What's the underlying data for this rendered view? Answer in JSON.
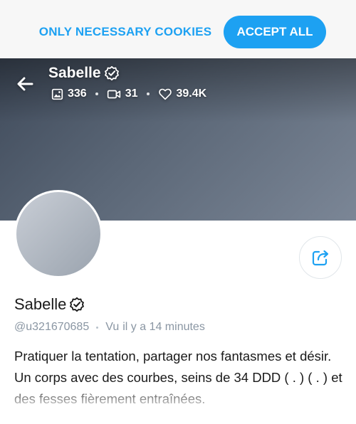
{
  "cookie_banner": {
    "necessary_label": "ONLY NECESSARY COOKIES",
    "accept_label": "ACCEPT ALL",
    "accent_color": "#1da1f2"
  },
  "cover": {
    "name": "Sabelle",
    "stats": {
      "photos": "336",
      "videos": "31",
      "likes": "39.4K"
    },
    "icons": [
      "back-arrow-icon",
      "verified-badge-icon",
      "image-icon",
      "video-icon",
      "heart-icon"
    ]
  },
  "profile": {
    "name": "Sabelle",
    "username": "@u321670685",
    "seen_prefix": "Vu",
    "seen_time": "il y a 14 minutes",
    "bio": "Pratiquer la tentation, partager nos fantasmes et désir. Un corps avec des courbes, seins de 34 DDD ( . ) ( . ) et des fesses fièrement entraînées.",
    "share_icon": "share-icon"
  }
}
